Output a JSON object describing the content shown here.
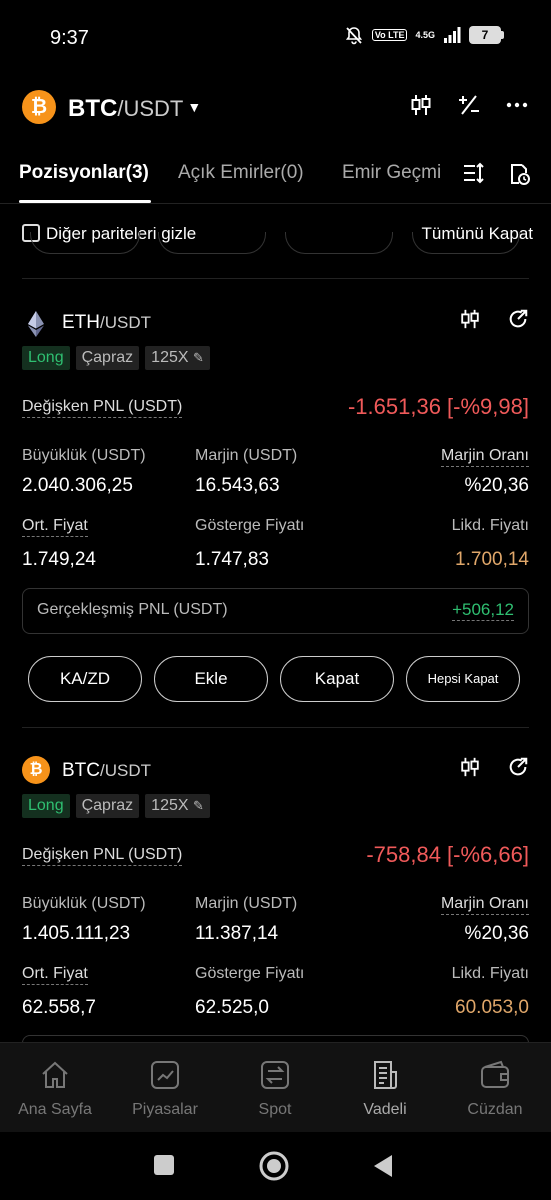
{
  "status_bar": {
    "time": "9:37",
    "volte": "Vo LTE",
    "network": "4.5G",
    "battery": "7"
  },
  "header": {
    "base": "BTC",
    "quote": "/USDT",
    "coin_glyph": "₿"
  },
  "tabs": [
    {
      "label": "Pozisyonlar(3)"
    },
    {
      "label": "Açık Emirler(0)"
    },
    {
      "label": "Emir Geçmi"
    }
  ],
  "filter": {
    "hide_label": "Diğer pariteleri gizle",
    "close_all": "Tümünü Kapat"
  },
  "positions": [
    {
      "base": "ETH",
      "quote": "/USDT",
      "tags": {
        "side": "Long",
        "mode": "Çapraz",
        "leverage": "125X"
      },
      "pnl_label": "Değişken PNL (USDT)",
      "pnl_value": "-1.651,36 [-%9,98]",
      "size_label": "Büyüklük (USDT)",
      "size": "2.040.306,25",
      "margin_label": "Marjin (USDT)",
      "margin": "16.543,63",
      "margin_ratio_label": "Marjin Oranı",
      "margin_ratio": "%20,36",
      "entry_label": "Ort. Fiyat",
      "entry": "1.749,24",
      "mark_label": "Gösterge Fiyatı",
      "mark": "1.747,83",
      "liq_label": "Likd. Fiyatı",
      "liq": "1.700,14",
      "realized_label": "Gerçekleşmiş PNL (USDT)",
      "realized": "+506,12",
      "buttons": {
        "tpsl": "KA/ZD",
        "add": "Ekle",
        "close": "Kapat",
        "close_all": "Hepsi Kapat"
      }
    },
    {
      "base": "BTC",
      "quote": "/USDT",
      "coin_glyph": "₿",
      "tags": {
        "side": "Long",
        "mode": "Çapraz",
        "leverage": "125X"
      },
      "pnl_label": "Değişken PNL (USDT)",
      "pnl_value": "-758,84 [-%6,66]",
      "size_label": "Büyüklük (USDT)",
      "size": "1.405.111,23",
      "margin_label": "Marjin (USDT)",
      "margin": "11.387,14",
      "margin_ratio_label": "Marjin Oranı",
      "margin_ratio": "%20,36",
      "entry_label": "Ort. Fiyat",
      "entry": "62.558,7",
      "mark_label": "Gösterge Fiyatı",
      "mark": "62.525,0",
      "liq_label": "Likd. Fiyatı",
      "liq": "60.053,0"
    }
  ],
  "bottom_nav": [
    {
      "label": "Ana Sayfa",
      "icon": "home-icon"
    },
    {
      "label": "Piyasalar",
      "icon": "markets-icon"
    },
    {
      "label": "Spot",
      "icon": "spot-icon"
    },
    {
      "label": "Vadeli",
      "icon": "futures-icon"
    },
    {
      "label": "Cüzdan",
      "icon": "wallet-icon"
    }
  ],
  "colors": {
    "loss": "#f05a5a",
    "profit": "#2fbf71",
    "liq": "#e0a76a",
    "btc": "#f7931a"
  }
}
